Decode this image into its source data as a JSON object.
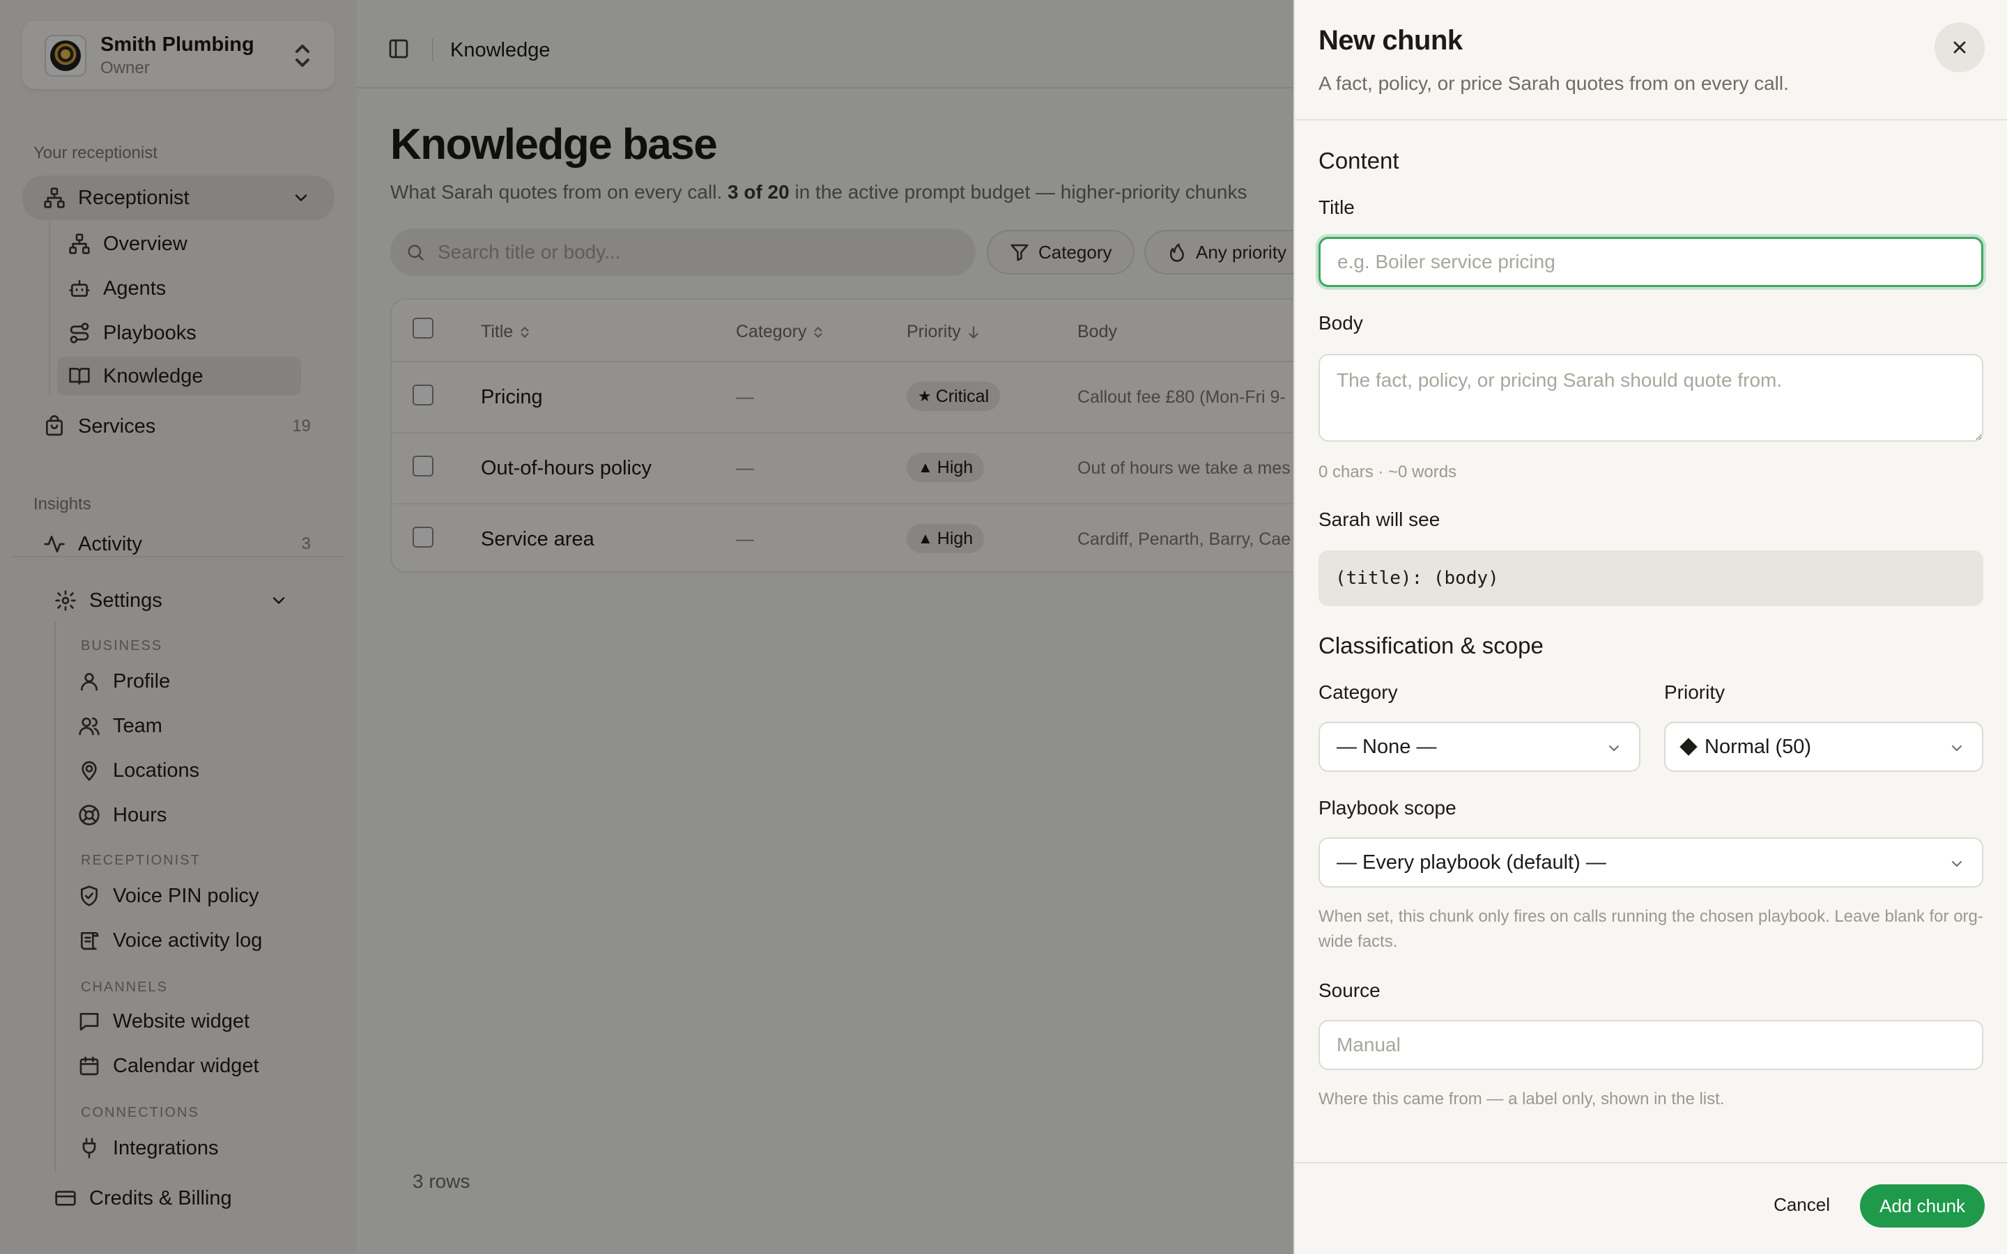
{
  "org": {
    "name": "Smith Plumbing",
    "role": "Owner"
  },
  "sidebar": {
    "section_receptionist": "Your receptionist",
    "receptionist": {
      "label": "Receptionist",
      "children": [
        "Overview",
        "Agents",
        "Playbooks",
        "Knowledge"
      ]
    },
    "services": {
      "label": "Services",
      "count": "19"
    },
    "section_insights": "Insights",
    "activity": {
      "label": "Activity",
      "count": "3"
    },
    "settings": {
      "label": "Settings",
      "group_business": "BUSINESS",
      "business": [
        "Profile",
        "Team",
        "Locations",
        "Hours"
      ],
      "group_receptionist": "RECEPTIONIST",
      "receptionist": [
        "Voice PIN policy",
        "Voice activity log"
      ],
      "group_channels": "CHANNELS",
      "channels": [
        "Website widget",
        "Calendar widget"
      ],
      "group_connections": "CONNECTIONS",
      "connections": [
        "Integrations"
      ]
    },
    "billing": "Credits & Billing"
  },
  "topbar": {
    "breadcrumb": "Knowledge"
  },
  "main": {
    "title": "Knowledge base",
    "description_pre": "What Sarah quotes from on every call. ",
    "description_bold": "3 of 20",
    "description_post": " in the active prompt budget — higher-priority chunks",
    "search_placeholder": "Search title or body...",
    "filter_category": "Category",
    "filter_priority": "Any priority",
    "columns": [
      "Title",
      "Category",
      "Priority",
      "Body"
    ],
    "rows": [
      {
        "title": "Pricing",
        "category": "—",
        "priority": "Critical",
        "priority_glyph": "★",
        "body": "Callout fee £80 (Mon-Fri 9-"
      },
      {
        "title": "Out-of-hours policy",
        "category": "—",
        "priority": "High",
        "priority_glyph": "▲",
        "body": "Out of hours we take a mes"
      },
      {
        "title": "Service area",
        "category": "—",
        "priority": "High",
        "priority_glyph": "▲",
        "body": "Cardiff, Penarth, Barry, Cae"
      }
    ],
    "rows_count": "3 rows"
  },
  "drawer": {
    "title": "New chunk",
    "subtitle": "A fact, policy, or price Sarah quotes from on every call.",
    "content_heading": "Content",
    "title_label": "Title",
    "title_placeholder": "e.g. Boiler service pricing",
    "title_value": "",
    "body_label": "Body",
    "body_placeholder": "The fact, policy, or pricing Sarah should quote from.",
    "body_stats": "0 chars · ~0 words",
    "preview_label": "Sarah will see",
    "preview_text": "(title): (body)",
    "classification_heading": "Classification & scope",
    "category_label": "Category",
    "category_value": "— None —",
    "priority_label": "Priority",
    "priority_value": "Normal (50)",
    "playbook_label": "Playbook scope",
    "playbook_value": "— Every playbook (default) —",
    "playbook_hint": "When set, this chunk only fires on calls running the chosen playbook. Leave blank for org-wide facts.",
    "source_label": "Source",
    "source_placeholder": "Manual",
    "source_hint": "Where this came from — a label only, shown in the list.",
    "cancel_label": "Cancel",
    "submit_label": "Add chunk"
  },
  "colors": {
    "accent_green": "#1f9a4b",
    "focus_ring": "#3aa862",
    "overlay": "rgba(0,0,0,0.42)"
  }
}
